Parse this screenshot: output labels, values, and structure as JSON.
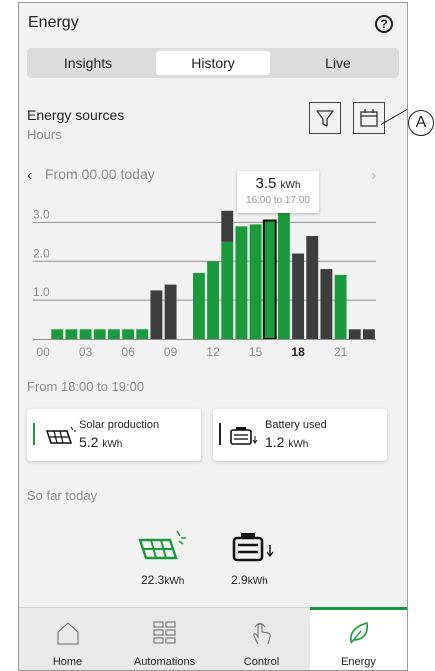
{
  "header": {
    "title": "Energy",
    "help_icon": "question-circle-icon",
    "help_glyph": "?"
  },
  "tabs": [
    {
      "label": "Insights",
      "active": false
    },
    {
      "label": "History",
      "active": true
    },
    {
      "label": "Live",
      "active": false
    }
  ],
  "section": {
    "title": "Energy sources",
    "subtitle": "Hours"
  },
  "toolbar": {
    "filter_icon": "filter-icon",
    "calendar_icon": "calendar-icon"
  },
  "annotation": {
    "label": "A"
  },
  "range": {
    "label": "From 00.00 today",
    "prev_glyph": "‹",
    "next_glyph": "›"
  },
  "tooltip": {
    "value": "3.5",
    "unit": "kWh",
    "time": "16:00 to 17:00"
  },
  "chart_data": {
    "type": "bar",
    "stacked": true,
    "ylim": [
      0,
      3.5
    ],
    "yticks": [
      "3.0",
      "2.0",
      "1.0"
    ],
    "xticks": [
      {
        "hour": 0,
        "label": "00",
        "bold": false
      },
      {
        "hour": 3,
        "label": "03",
        "bold": false
      },
      {
        "hour": 6,
        "label": "06",
        "bold": false
      },
      {
        "hour": 9,
        "label": "09",
        "bold": false
      },
      {
        "hour": 12,
        "label": "12",
        "bold": false
      },
      {
        "hour": 15,
        "label": "15",
        "bold": false
      },
      {
        "hour": 18,
        "label": "18",
        "bold": true
      },
      {
        "hour": 21,
        "label": "21",
        "bold": false
      }
    ],
    "selected_hour": 16,
    "series": [
      {
        "color": "#1a9a3c",
        "values": [
          0.0,
          0.25,
          0.25,
          0.25,
          0.25,
          0.25,
          0.25,
          0.25,
          0.0,
          0.0,
          0.0,
          1.7,
          2.0,
          2.5,
          2.9,
          2.95,
          3.05,
          3.35,
          0.0,
          0.0,
          0.0,
          1.65,
          0.0,
          0.0
        ]
      },
      {
        "color": "#3d3d3d",
        "values": [
          0.0,
          0.0,
          0.0,
          0.0,
          0.0,
          0.0,
          0.0,
          0.0,
          1.25,
          1.4,
          0.0,
          0.0,
          0.0,
          0.8,
          0.0,
          0.0,
          0.0,
          0.0,
          2.2,
          2.65,
          1.8,
          0.0,
          0.25,
          0.25
        ]
      }
    ]
  },
  "hour_range": "From 18:00 to 19:00",
  "cards": [
    {
      "label": "Solar production",
      "value": "5.2",
      "unit": "kWh",
      "accent": "#1a9a3c",
      "icon": "solar-panel-icon"
    },
    {
      "label": "Battery used",
      "value": "1.2",
      "unit": "kWh",
      "accent": "#222222",
      "icon": "battery-icon"
    }
  ],
  "so_far": {
    "label": "So far today",
    "solar": {
      "value": "22.3",
      "unit": "kWh",
      "icon": "solar-panel-icon"
    },
    "battery": {
      "value": "2.9",
      "unit": "kWh",
      "icon": "battery-icon"
    }
  },
  "nav": [
    {
      "label": "Home",
      "icon": "home-icon",
      "active": false
    },
    {
      "label": "Automations",
      "icon": "automations-grid-icon",
      "active": false
    },
    {
      "label": "Control",
      "icon": "touch-hand-icon",
      "active": false
    },
    {
      "label": "Energy",
      "icon": "leaf-icon",
      "active": true
    }
  ],
  "colors": {
    "green": "#1a9a3c",
    "dark": "#3d3d3d",
    "background": "#f2f2f2"
  }
}
